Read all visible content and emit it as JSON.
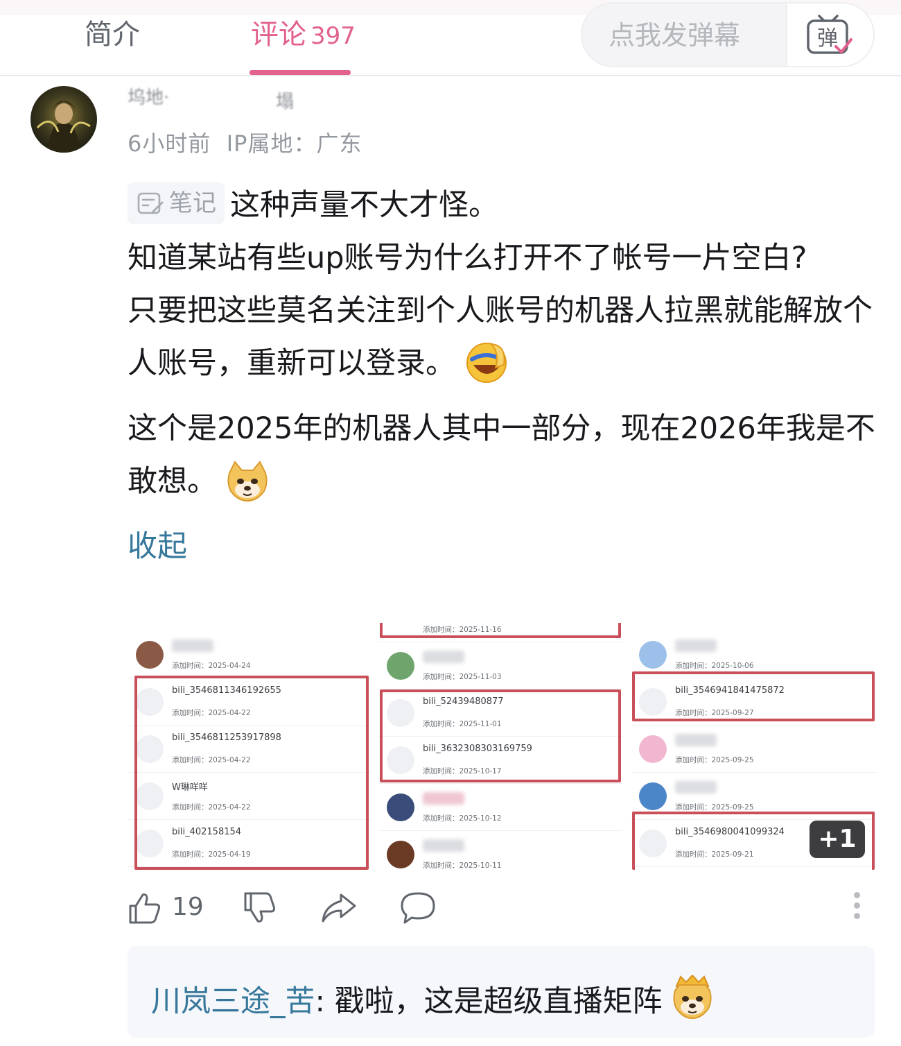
{
  "tabs": {
    "intro_label": "简介",
    "comments_label": "评论",
    "comments_count": "397"
  },
  "danmu": {
    "placeholder": "点我发弹幕",
    "toggle_icon": "danmu-toggle-icon",
    "toggle_glyph": "弹"
  },
  "comment": {
    "username_visible": [
      "坞地·",
      "塌"
    ],
    "time": "6小时前",
    "ip_location": "IP属地：广东",
    "note_tag": "笔记",
    "lines": [
      "这种声量不大才怪。",
      "知道某站有些up账号为什么打开不了帐号一片空白?",
      "只要把这些莫名关注到个人账号的机器人拉黑就能解放个人账号，重新可以登录。",
      "这个是2025年的机器人其中一部分，现在2026年我是不敢想。"
    ],
    "collapse_label": "收起"
  },
  "images": {
    "panel_1": [
      {
        "name": "",
        "time": "添加时间：2025-04-24"
      },
      {
        "name": "bili_3546811346192655",
        "time": "添加时间：2025-04-22"
      },
      {
        "name": "bili_3546811253917898",
        "time": "添加时间：2025-04-22"
      },
      {
        "name": "W琳咩咩",
        "time": "添加时间：2025-04-22"
      },
      {
        "name": "bili_402158154",
        "time": "添加时间：2025-04-19"
      }
    ],
    "panel_2": [
      {
        "name": "",
        "time": "添加时间：2025-11-16"
      },
      {
        "name": "",
        "time": "添加时间：2025-11-03"
      },
      {
        "name": "bili_52439480877",
        "time": "添加时间：2025-11-01"
      },
      {
        "name": "bili_3632308303169759",
        "time": "添加时间：2025-10-17"
      },
      {
        "name": "",
        "time": "添加时间：2025-10-12"
      },
      {
        "name": "",
        "time": "添加时间：2025-10-11"
      }
    ],
    "panel_3": [
      {
        "name": "",
        "time": "添加时间：2025-10-06"
      },
      {
        "name": "bili_3546941841475872",
        "time": "添加时间：2025-09-27"
      },
      {
        "name": "",
        "time": "添加时间：2025-09-25"
      },
      {
        "name": "",
        "time": "添加时间：2025-09-25"
      },
      {
        "name": "bili_3546980041099324",
        "time": "添加时间：2025-09-21"
      }
    ],
    "more_badge": "+1"
  },
  "actions": {
    "like_count": "19",
    "icons": [
      "thumbs-up-icon",
      "thumbs-down-icon",
      "share-icon",
      "reply-icon",
      "more-icon"
    ]
  },
  "reply": {
    "user": "川岚三途_苦",
    "separator": ": ",
    "text": "戳啦，这是超级直播矩阵"
  },
  "colors": {
    "accent_pink": "#e2618e",
    "link_blue": "#36789c",
    "highlight_red": "#c9505a"
  }
}
